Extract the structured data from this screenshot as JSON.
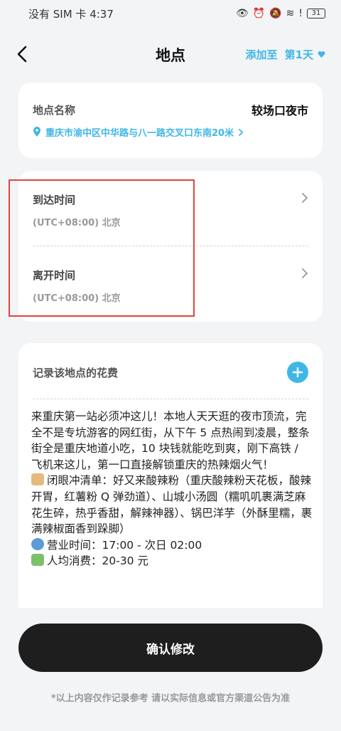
{
  "status_bar": {
    "carrier_time": "没有 SIM 卡 4:37",
    "battery": "31"
  },
  "header": {
    "title": "地点",
    "add_to_label": "添加至",
    "day_label": "第1天"
  },
  "place": {
    "name_label": "地点名称",
    "name_value": "较场口夜市",
    "address": "重庆市渝中区中华路与八一路交叉口东南20米"
  },
  "time": {
    "arrive_label": "到达时间",
    "arrive_tz": "(UTC+08:00) 北京",
    "leave_label": "离开时间",
    "leave_tz": "(UTC+08:00) 北京"
  },
  "cost": {
    "title": "记录该地点的花费",
    "text_intro": "来重庆第一站必须冲这儿！本地人天天逛的夜市顶流，完全不是专坑游客的网红街，从下午 5 点热闹到凌晨，整条街全是重庆地道小吃，10 块钱就能吃到爽，刚下高铁 / 飞机来这儿，第一口直接解锁重庆的热辣烟火气！",
    "text_list": "闭眼冲清单：好又来酸辣粉（重庆酸辣粉天花板，酸辣开胃，红薯粉 Q 弹劲道）、山城小汤圆（糯叽叽裹满芝麻花生碎，热乎香甜，解辣神器）、锅巴洋芋（外酥里糯，裹满辣椒面香到跺脚）",
    "text_hours": "营业时间：17:00 - 次日 02:00",
    "text_price": "人均消费：20-30 元"
  },
  "footer": {
    "confirm_label": "确认修改",
    "disclaimer": "*以上内容仅作记录参考 请以实际信息或官方渠道公告为准"
  },
  "colors": {
    "accent": "#3fb7e6",
    "highlight": "#e0453c",
    "button": "#1e1e1e"
  },
  "icons": [
    "back-icon",
    "heart-icon",
    "pin-icon",
    "chevron-right-icon",
    "plus-icon"
  ]
}
